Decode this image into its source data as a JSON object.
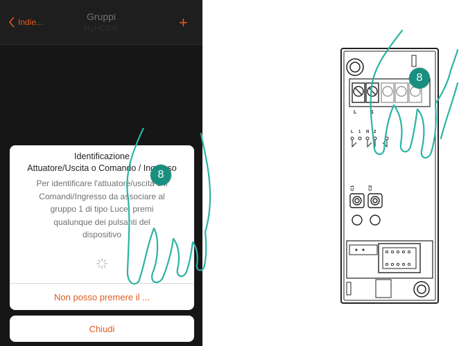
{
  "header": {
    "back_label": "Indie...",
    "title": "Gruppi",
    "subtitle": "MyHOME",
    "add_label": "+"
  },
  "dialog": {
    "title_line1": "Identificazione",
    "title_line2": "Attuatore/Uscita o Comando / Ingresso",
    "body_lines": [
      "Per identificare l'attuatore/uscita o il",
      "Comandi/Ingresso da associare al",
      "gruppo 1 di tipo Luce, premi",
      "qualunque dei pulsanti del",
      "dispositivo"
    ],
    "action_label": "Non posso premere il ..."
  },
  "close_label": "Chiudi",
  "step_badge_phone": "8",
  "step_badge_device": "8",
  "device": {
    "terminal_labels": [
      "L",
      "1"
    ],
    "contact_labels": [
      "L",
      "1",
      "N",
      "2"
    ],
    "button_labels": [
      "C1",
      "C2"
    ]
  },
  "colors": {
    "accent": "#e05a1e",
    "badge": "#188f80",
    "hand_outline": "#2bb3a3",
    "phone_background": "#161616"
  }
}
